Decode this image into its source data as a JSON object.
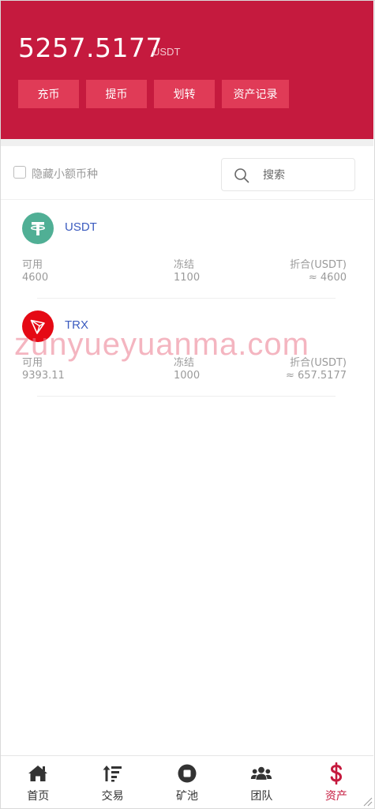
{
  "header": {
    "balance": "5257.5177",
    "unit": "USDT",
    "buttons": [
      "充币",
      "提币",
      "划转",
      "资产记录"
    ]
  },
  "filter": {
    "hide_small_label": "隐藏小额币种",
    "search_placeholder": "搜索"
  },
  "assets": [
    {
      "name": "USDT",
      "icon": "tether-icon",
      "available_label": "可用",
      "available": "4600",
      "frozen_label": "冻结",
      "frozen": "1100",
      "converted_label": "折合(USDT)",
      "converted": "≈ 4600"
    },
    {
      "name": "TRX",
      "icon": "tron-icon",
      "available_label": "可用",
      "available": "9393.11",
      "frozen_label": "冻结",
      "frozen": "1000",
      "converted_label": "折合(USDT)",
      "converted": "≈ 657.5177"
    }
  ],
  "watermark": "zunyueyuanma.com",
  "tabbar": {
    "items": [
      {
        "label": "首页",
        "icon": "home-icon"
      },
      {
        "label": "交易",
        "icon": "sort-icon"
      },
      {
        "label": "矿池",
        "icon": "stop-circle-icon"
      },
      {
        "label": "团队",
        "icon": "users-icon"
      },
      {
        "label": "资产",
        "icon": "dollar-icon"
      }
    ],
    "active_index": 4
  },
  "colors": {
    "brand": "#c51a3e",
    "button": "#e03b57",
    "link": "#3b5bbf",
    "muted": "#9a9a9a"
  }
}
